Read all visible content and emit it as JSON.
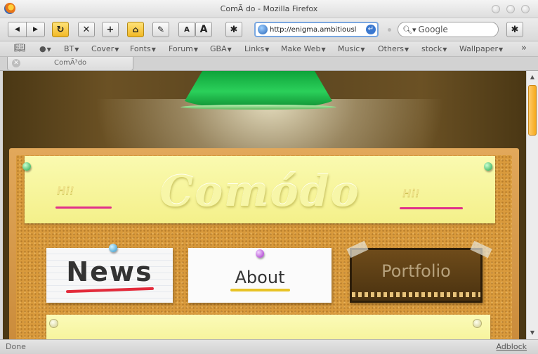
{
  "window": {
    "title": "ComÃ do - Mozilla Firefox"
  },
  "toolbar": {
    "back_icon": "back-arrow",
    "forward_icon": "forward-arrow",
    "reload_icon": "reload",
    "stop_icon": "stop",
    "new_tab_icon": "plus",
    "home_icon": "home",
    "edit_icon": "pencil",
    "font_small": "A",
    "font_large": "A",
    "bug_icon": "spider",
    "url": "http://enigma.ambitiousl",
    "search_placeholder": "Google"
  },
  "bookmarks": {
    "items": [
      {
        "label": "BT"
      },
      {
        "label": "Cover"
      },
      {
        "label": "Fonts"
      },
      {
        "label": "Forum"
      },
      {
        "label": "GBA"
      },
      {
        "label": "Links"
      },
      {
        "label": "Make Web"
      },
      {
        "label": "Music"
      },
      {
        "label": "Others"
      },
      {
        "label": "stock"
      },
      {
        "label": "Wallpaper"
      }
    ],
    "overflow": "»"
  },
  "tabs": [
    {
      "label": "ComÃ³do",
      "active": true
    }
  ],
  "page": {
    "banner": {
      "logo": "Comódo",
      "hi_left": "Hi!",
      "hi_right": "Hi!"
    },
    "cards": {
      "news": "News",
      "about": "About",
      "portfolio": "Portfolio"
    }
  },
  "statusbar": {
    "status": "Done",
    "addon": "Adblock"
  },
  "colors": {
    "lamp": "#1fbf4c",
    "cork": "#d99a3c",
    "banner": "#f4f08a",
    "news_underline": "#e32a3a",
    "about_underline": "#e8c326",
    "hi_underline": "#e0308a"
  }
}
